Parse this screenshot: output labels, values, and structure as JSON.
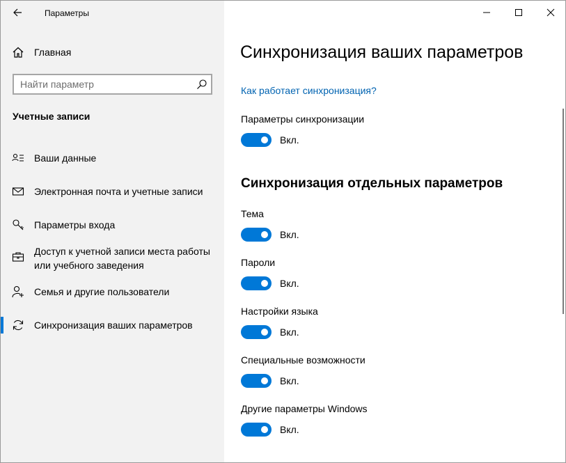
{
  "window": {
    "title": "Параметры"
  },
  "sidebar": {
    "home_label": "Главная",
    "search_placeholder": "Найти параметр",
    "section_header": "Учетные записи",
    "items": [
      {
        "label": "Ваши данные",
        "icon": "person-card-icon",
        "selected": false
      },
      {
        "label": "Электронная почта и учетные записи",
        "icon": "mail-icon",
        "selected": false
      },
      {
        "label": "Параметры входа",
        "icon": "key-icon",
        "selected": false
      },
      {
        "label": "Доступ к учетной записи места работы или учебного заведения",
        "icon": "briefcase-icon",
        "selected": false
      },
      {
        "label": "Семья и другие пользователи",
        "icon": "person-add-icon",
        "selected": false
      },
      {
        "label": "Синхронизация ваших параметров",
        "icon": "sync-icon",
        "selected": true
      }
    ]
  },
  "main": {
    "title": "Синхронизация ваших параметров",
    "help_link": "Как работает синхронизация?",
    "master": {
      "label": "Параметры синхронизации",
      "state": "Вкл.",
      "on": true
    },
    "individual_header": "Синхронизация отдельных параметров",
    "settings": [
      {
        "label": "Тема",
        "state": "Вкл.",
        "on": true
      },
      {
        "label": "Пароли",
        "state": "Вкл.",
        "on": true
      },
      {
        "label": "Настройки языка",
        "state": "Вкл.",
        "on": true
      },
      {
        "label": "Специальные возможности",
        "state": "Вкл.",
        "on": true
      },
      {
        "label": "Другие параметры Windows",
        "state": "Вкл.",
        "on": true
      }
    ]
  },
  "colors": {
    "accent": "#0078d7",
    "link": "#0063b1",
    "sidebar_bg": "#f2f2f2"
  }
}
